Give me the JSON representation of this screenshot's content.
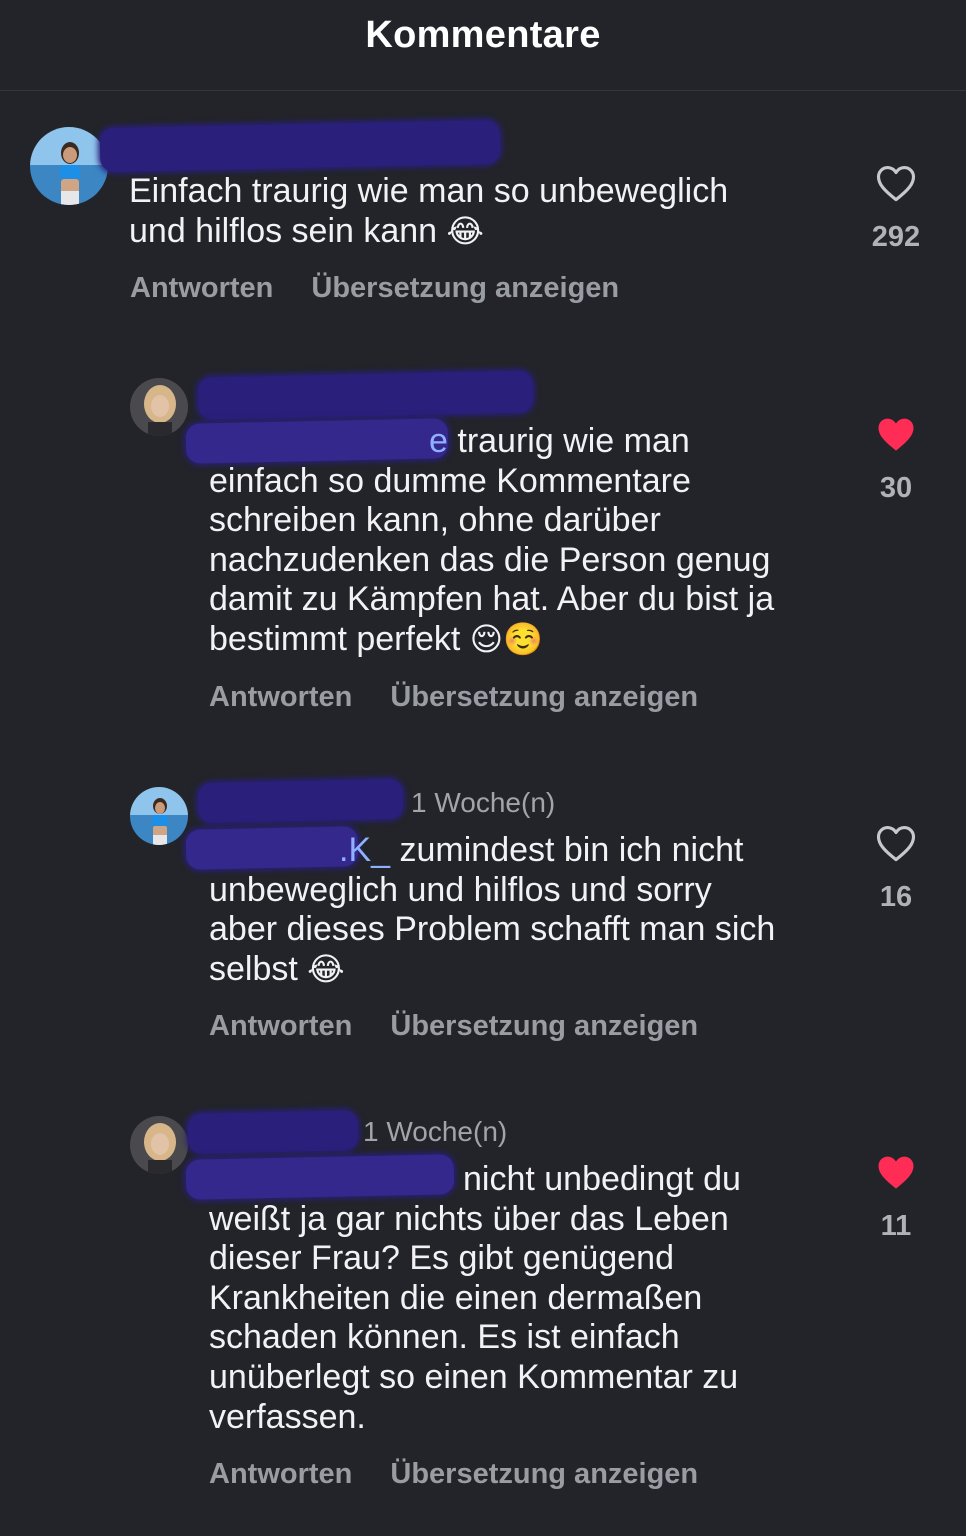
{
  "header": {
    "title": "Kommentare"
  },
  "colors": {
    "background": "#222429",
    "liked": "#ff2d55",
    "unliked": "#c8c8cc",
    "redaction": "#2a1f7a"
  },
  "comments": [
    {
      "username": "",
      "time": "",
      "mention": "",
      "text": "Einfach traurig wie man so unbeweglich\nund hilflos sein kann",
      "emoji": "😂",
      "likes": "292",
      "liked": false,
      "reply_label": "Antworten",
      "translate_label": "Übersetzung anzeigen",
      "like_icon": "heart-outline-icon"
    },
    {
      "username": "",
      "time": "",
      "mention": "e",
      "text": " traurig wie man\neinfach so dumme Kommentare\nschreiben kann, ohne darüber\nnachzudenken das die Person genug\ndamit zu Kämpfen hat. Aber du bist ja\nbestimmt perfekt",
      "emoji": "😌☺️",
      "likes": "30",
      "liked": true,
      "reply_label": "Antworten",
      "translate_label": "Übersetzung anzeigen",
      "like_icon": "heart-filled-icon"
    },
    {
      "username": "",
      "time": "1 Woche(n)",
      "mention": ".K_",
      "text": " zumindest bin ich nicht\nunbeweglich und hilflos und sorry\naber dieses Problem schafft man sich\nselbst",
      "emoji": "😂",
      "likes": "16",
      "liked": false,
      "reply_label": "Antworten",
      "translate_label": "Übersetzung anzeigen",
      "like_icon": "heart-outline-icon"
    },
    {
      "username": "",
      "time": "1 Woche(n)",
      "mention": "",
      "text": "nicht unbedingt du\nweißt ja gar nichts über das Leben\ndieser Frau? Es gibt genügend\nKrankheiten die einen dermaßen\nschaden können. Es ist einfach\nunüberlegt so einen Kommentar zu\nverfassen.",
      "emoji": "",
      "likes": "11",
      "liked": true,
      "reply_label": "Antworten",
      "translate_label": "Übersetzung anzeigen",
      "like_icon": "heart-filled-icon"
    }
  ]
}
